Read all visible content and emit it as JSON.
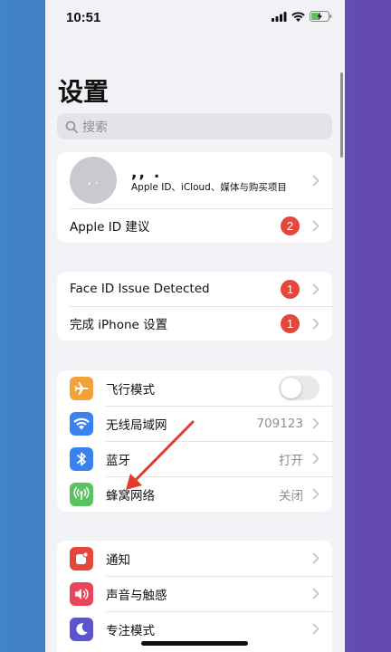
{
  "status_bar": {
    "time": "10:51"
  },
  "title": "设置",
  "search": {
    "placeholder": "搜索"
  },
  "profile": {
    "avatar_text": ", .",
    "name": ",, .",
    "subtitle": "Apple ID、iCloud、媒体与购买项目",
    "suggestion_label": "Apple ID 建议",
    "suggestion_badge": "2"
  },
  "alerts": [
    {
      "label": "Face ID Issue Detected",
      "badge": "1"
    },
    {
      "label": "完成 iPhone 设置",
      "badge": "1"
    }
  ],
  "connectivity": [
    {
      "label": "飞行模式",
      "icon": "airplane-icon",
      "color": "#f1a33a",
      "toggle_on": false
    },
    {
      "label": "无线局域网",
      "icon": "wifi-icon",
      "color": "#3b82f1",
      "value": "709123"
    },
    {
      "label": "蓝牙",
      "icon": "bluetooth-icon",
      "color": "#3b82f1",
      "value": "打开"
    },
    {
      "label": "蜂窝网络",
      "icon": "cellular-icon",
      "color": "#5cc25f",
      "value": "关闭"
    }
  ],
  "notifications_group": [
    {
      "label": "通知",
      "icon": "notification-icon",
      "color": "#e5483b"
    },
    {
      "label": "声音与触感",
      "icon": "sound-icon",
      "color": "#e8445a"
    },
    {
      "label": "专注模式",
      "icon": "moon-icon",
      "color": "#5a55cc"
    }
  ],
  "colors": {
    "badge": "#e5483b",
    "annotation_arrow": "#e53a2e"
  }
}
